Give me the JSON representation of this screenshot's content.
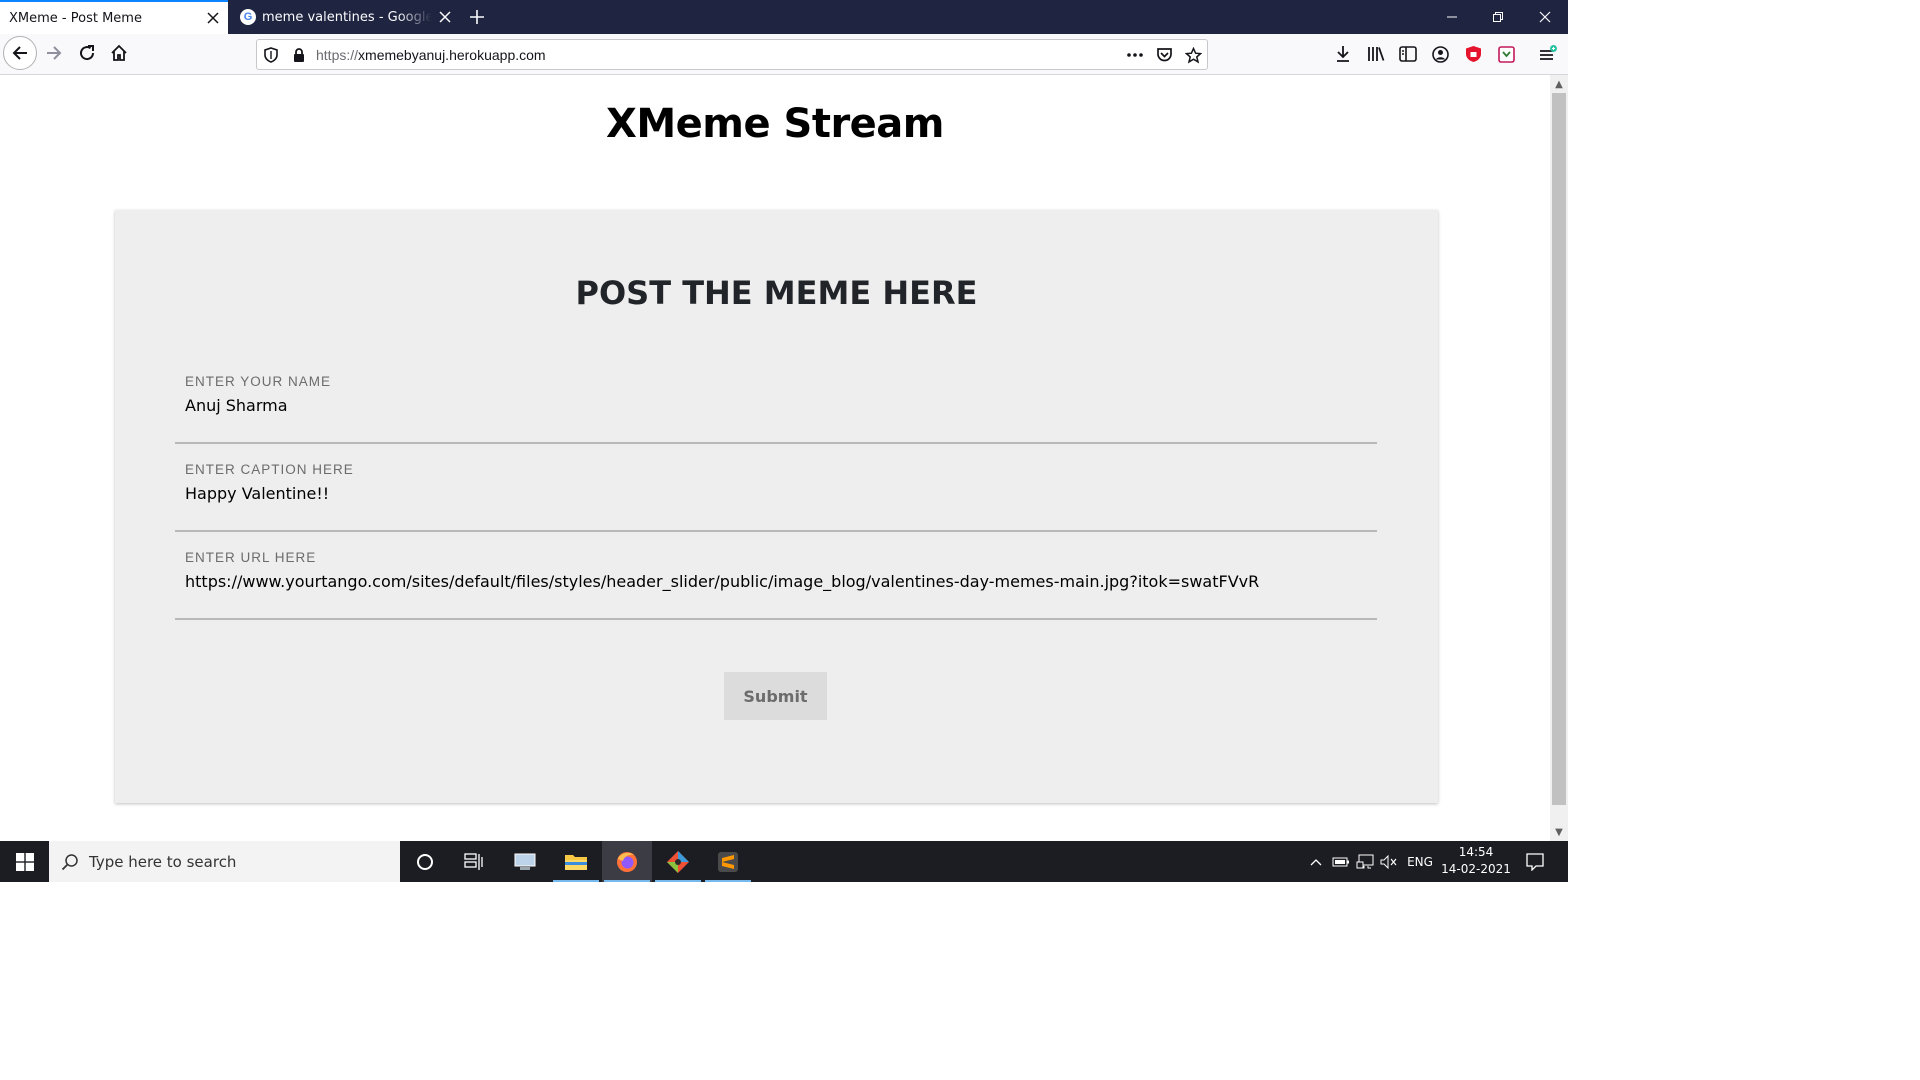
{
  "tabs": [
    {
      "title": "XMeme - Post Meme",
      "active": true
    },
    {
      "title": "meme valentines - Google Search",
      "active": false
    }
  ],
  "url": {
    "scheme": "https://",
    "host": "xmemebyanuj.herokuapp.com"
  },
  "page": {
    "title": "XMeme Stream",
    "form_title": "POST THE MEME HERE",
    "fields": [
      {
        "label": "ENTER YOUR NAME",
        "value": "Anuj Sharma"
      },
      {
        "label": "ENTER CAPTION HERE",
        "value": "Happy Valentine!!"
      },
      {
        "label": "ENTER URL HERE",
        "value": "https://www.yourtango.com/sites/default/files/styles/header_slider/public/image_blog/valentines-day-memes-main.jpg?itok=swatFVvR"
      }
    ],
    "submit_label": "Submit"
  },
  "taskbar": {
    "search_placeholder": "Type here to search",
    "language": "ENG",
    "time": "14:54",
    "date": "14-02-2021"
  },
  "colors": {
    "tabstrip": "#1f2440",
    "accent": "#0a84ff",
    "card_bg": "#eeeeee",
    "taskbar": "#1c1d22"
  }
}
